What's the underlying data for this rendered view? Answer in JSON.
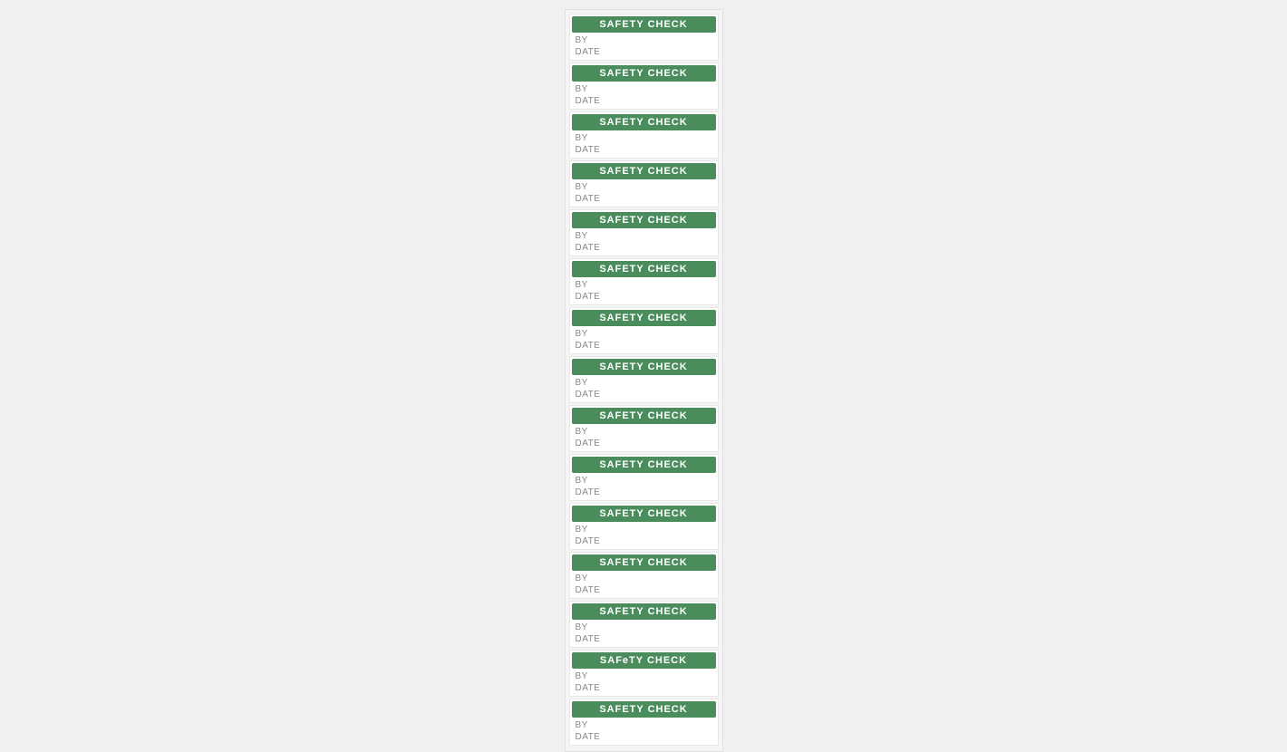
{
  "labels": [
    {
      "title": "SAFETY CHECK",
      "by_label": "BY",
      "date_label": "DATE"
    },
    {
      "title": "SAFETY CHECK",
      "by_label": "BY",
      "date_label": "DATE"
    },
    {
      "title": "SAFETY CHECK",
      "by_label": "BY",
      "date_label": "DATE"
    },
    {
      "title": "SAFETY CHECK",
      "by_label": "BY",
      "date_label": "DATE"
    },
    {
      "title": "SAFETY CHECK",
      "by_label": "BY",
      "date_label": "DATE"
    },
    {
      "title": "SAFETY CHECK",
      "by_label": "BY",
      "date_label": "DATE"
    },
    {
      "title": "SAFETY CHECK",
      "by_label": "BY",
      "date_label": "DATE"
    },
    {
      "title": "SAFETY CHECK",
      "by_label": "BY",
      "date_label": "DATE"
    },
    {
      "title": "SAFETY CHECK",
      "by_label": "BY",
      "date_label": "DATE"
    },
    {
      "title": "SAFETY CHECK",
      "by_label": "BY",
      "date_label": "DATE"
    },
    {
      "title": "SAFETY CHECK",
      "by_label": "BY",
      "date_label": "DATE"
    },
    {
      "title": "SAFETY CHECK",
      "by_label": "BY",
      "date_label": "DATE"
    },
    {
      "title": "SAFETY CHECK",
      "by_label": "BY",
      "date_label": "DATE"
    },
    {
      "title": "SAFeTY CHECK",
      "by_label": "BY",
      "date_label": "DATE"
    },
    {
      "title": "SAFETY CHECK",
      "by_label": "BY",
      "date_label": "DATE"
    }
  ],
  "colors": {
    "header_bg": "#4a8c5c",
    "header_text": "#ffffff",
    "field_text": "#888888",
    "sheet_bg": "#f5f5f5",
    "page_bg": "#f0f0f0"
  }
}
